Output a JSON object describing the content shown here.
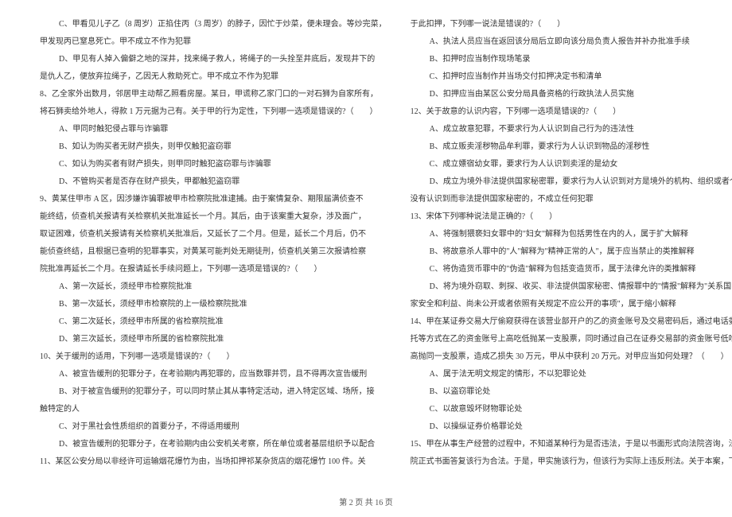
{
  "left": [
    {
      "cls": "indent1",
      "t": "C、甲看见儿子乙（8 周岁）正掐住丙（3 周岁）的脖子，因忙于炒菜，便未理会。等炒完菜，"
    },
    {
      "cls": "indent2",
      "t": "甲发现丙已窒息死亡。甲不成立不作为犯罪"
    },
    {
      "cls": "indent1",
      "t": "D、甲见有人掉入偏僻之地的深井，找来绳子救人，将绳子的一头拴至井底后，发现井下的"
    },
    {
      "cls": "indent2",
      "t": "是仇人乙，便放弃拉绳子，乙因无人救助死亡。甲不成立不作为犯罪"
    },
    {
      "cls": "indent2",
      "t": "8、乙全家外出数月，邻居甲主动帮乙照看房屋。某日，甲谎称乙家门口的一对石狮为自家所有，"
    },
    {
      "cls": "indent2",
      "t": "将石狮卖给外地人，得款 1 万元据为己有。关于甲的行为定性，下列哪一选项是错误的?（　　）"
    },
    {
      "cls": "indent1",
      "t": "A、甲同时触犯侵占罪与诈骗罪"
    },
    {
      "cls": "indent1",
      "t": "B、如认为购买者无财产损失，则甲仅触犯盗窃罪"
    },
    {
      "cls": "indent1",
      "t": "C、如认为购买者有财产损失，则甲同时触犯盗窃罪与诈骗罪"
    },
    {
      "cls": "indent1",
      "t": "D、不管购买者是否存在财产损失，甲都触犯盗窃罪"
    },
    {
      "cls": "indent2",
      "t": "9、黄某住甲市 A 区，因涉嫌诈骗罪被甲市检察院批准逮捕。由于案情复杂、期限届满侦查不"
    },
    {
      "cls": "indent2",
      "t": "能终结，侦查机关报请有关检察机关批准延长一个月。其后，由于该案重大复杂，涉及面广，"
    },
    {
      "cls": "indent2",
      "t": "取证困难，侦查机关报请有关检察机关批准后，又延长了二个月。但是，延长二个月后，仍不"
    },
    {
      "cls": "indent2",
      "t": "能侦查终结，且根据已查明的犯罪事实，对黄某可能判处无期徒刑，侦查机关第三次报请检察"
    },
    {
      "cls": "indent2",
      "t": "院批准再延长二个月。在报请延长手续问题上，下列哪一选项是错误的?（　　）"
    },
    {
      "cls": "indent1",
      "t": "A、第一次延长，须经甲市检察院批准"
    },
    {
      "cls": "indent1",
      "t": "B、第一次延长，须经甲市检察院的上一级检察院批准"
    },
    {
      "cls": "indent1",
      "t": "C、第二次延长，须经甲市所属的省检察院批准"
    },
    {
      "cls": "indent1",
      "t": "D、第三次延长，须经甲市所属的省检察院批准"
    },
    {
      "cls": "indent2",
      "t": "10、关于缓刑的适用，下列哪一选项是错误的?（　　）"
    },
    {
      "cls": "indent1",
      "t": "A、被宣告缓刑的犯罪分子，在考验期内再犯罪的，应当数罪并罚，且不得再次宣告缓刑"
    },
    {
      "cls": "indent1",
      "t": "B、对于被宣告缓刑的犯罪分子，可以同时禁止其从事特定活动，进入特定区域、场所，接"
    },
    {
      "cls": "indent2",
      "t": "触特定的人"
    },
    {
      "cls": "indent1",
      "t": "C、对于黑社会性质组织的首要分子，不得适用缓刑"
    },
    {
      "cls": "indent1",
      "t": "D、被宣告缓刑的犯罪分子，在考验期内由公安机关考察，所在单位或者基层组织予以配合"
    },
    {
      "cls": "indent2",
      "t": "11、某区公安分局以非经许可运输烟花爆竹为由，当场扣押祁某杂货店的烟花爆竹 100 件。关"
    }
  ],
  "right": [
    {
      "cls": "indent2",
      "t": "于此扣押，下列哪一说法是错误的?（　　）"
    },
    {
      "cls": "indent1",
      "t": "A、执法人员应当在返回该分局后立即向该分局负责人报告并补办批准手续"
    },
    {
      "cls": "indent1",
      "t": "B、扣押时应当制作现场笔录"
    },
    {
      "cls": "indent1",
      "t": "C、扣押时应当制作并当场交付扣押决定书和清单"
    },
    {
      "cls": "indent1",
      "t": "D、扣押应当由某区公安分局具备资格的行政执法人员实施"
    },
    {
      "cls": "indent2",
      "t": "12、关于故意的认识内容，下列哪一选项是错误的?（　　）"
    },
    {
      "cls": "indent1",
      "t": "A、成立故意犯罪，不要求行为人认识到自己行为的违法性"
    },
    {
      "cls": "indent1",
      "t": "B、成立贩卖淫秽物品牟利罪，要求行为人认识到物品的淫秽性"
    },
    {
      "cls": "indent1",
      "t": "C、成立嫖宿幼女罪，要求行为人认识到卖淫的是幼女"
    },
    {
      "cls": "indent1",
      "t": "D、成立为境外非法提供国家秘密罪，要求行为人认识到对方是境外的机构、组织或者个人，"
    },
    {
      "cls": "indent2",
      "t": "没有认识到而非法提供国家秘密的，不成立任何犯罪"
    },
    {
      "cls": "indent2",
      "t": "13、宋体下列哪种说法是正确的?（　　）"
    },
    {
      "cls": "indent1",
      "t": "A、将强制猥亵妇女罪中的\"妇女\"解释为包括男性在内的人，属于扩大解释"
    },
    {
      "cls": "indent1",
      "t": "B、将故意杀人罪中的\"人\"解释为\"精神正常的人\"，属于应当禁止的类推解释"
    },
    {
      "cls": "indent1",
      "t": "C、将伪造货币罪中的\"伪造\"解释为包括变造货币，属于法律允许的类推解释"
    },
    {
      "cls": "indent1",
      "t": "D、将为境外窃取、刺探、收买、非法提供国家秘密、情报罪中的\"情报\"解释为\"关系国"
    },
    {
      "cls": "indent2",
      "t": "家安全和利益、尚未公开或者依照有关规定不应公开的事项\"，属于缩小解释"
    },
    {
      "cls": "indent2",
      "t": "14、甲在某证券交易大厅偷窥获得在该营业部开户的乙的资金账号及交易密码后，通过电话委"
    },
    {
      "cls": "indent2",
      "t": "托等方式在乙的资金账号上高吃低抛某一支股票，同时通过自己在证券交易部的资金账号低吃"
    },
    {
      "cls": "indent2",
      "t": "高抛同一支股票，造成乙损失 30 万元，甲从中获利 20 万元。对甲应当如何处理？（　　）"
    },
    {
      "cls": "indent1",
      "t": "A、属于法无明文规定的情形，不以犯罪论处"
    },
    {
      "cls": "indent1",
      "t": "B、以盗窃罪论处"
    },
    {
      "cls": "indent1",
      "t": "C、以故意毁坏财物罪论处"
    },
    {
      "cls": "indent1",
      "t": "D、以操纵证券价格罪论处"
    },
    {
      "cls": "indent2",
      "t": "15、甲在从事生产经营的过程中，不知道某种行为是否违法，于是以书面形式向法院咨询，法"
    },
    {
      "cls": "indent2",
      "t": "院正式书面答复该行为合法。于是，甲实施该行为，但该行为实际上违反刑法。关于本案，下"
    }
  ],
  "footer": "第 2 页 共 16 页"
}
